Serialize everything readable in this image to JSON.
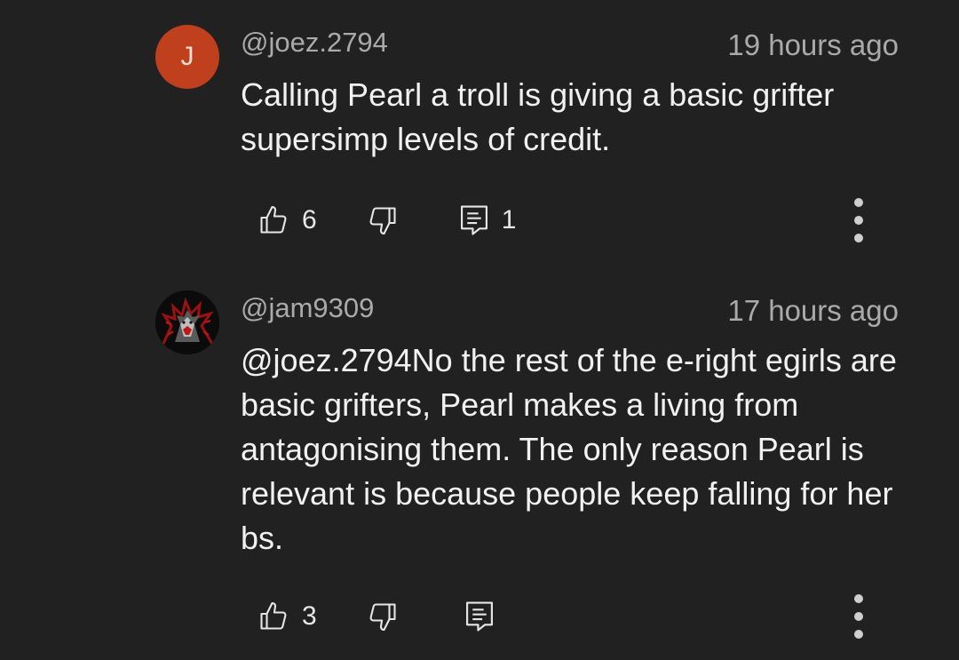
{
  "comments": [
    {
      "avatar_letter": "J",
      "avatar_color": "#c0401d",
      "handle": "@joez.2794",
      "time": "19 hours ago",
      "text": "Calling Pearl a troll is giving a basic grifter supersimp levels of credit.",
      "likes": "6",
      "replies": "1"
    },
    {
      "avatar_letter": "",
      "handle": "@jam9309",
      "time": "17 hours ago",
      "text": "@joez.2794No the rest of the e-right egirls are basic grifters, Pearl makes a living from antagonising them. The only reason Pearl is relevant is because people keep falling for her bs.",
      "likes": "3",
      "replies": ""
    }
  ],
  "icons": {
    "like": "thumbs-up-icon",
    "dislike": "thumbs-down-icon",
    "reply": "comment-reply-icon",
    "more": "vertical-dots-icon"
  }
}
